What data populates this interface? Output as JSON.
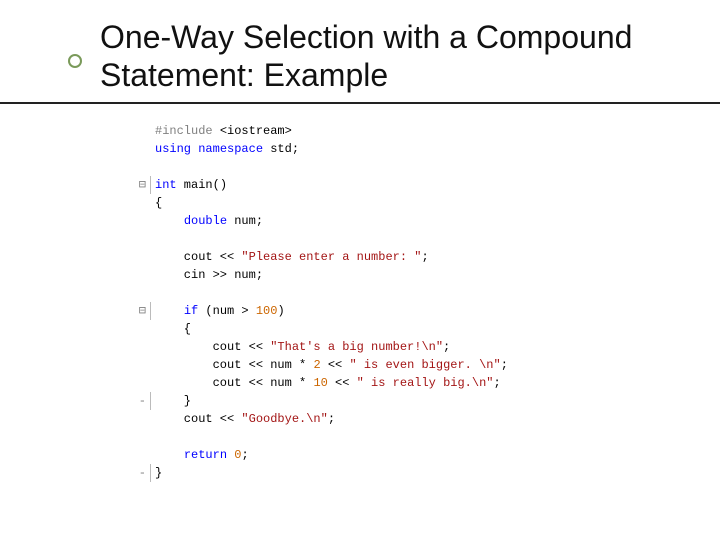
{
  "title": "One-Way Selection with a Compound Statement: Example",
  "code_lines": [
    {
      "gutter": "",
      "html": "<span class='pre'>#include </span><span class='inc'>&lt;iostream&gt;</span>"
    },
    {
      "gutter": "",
      "html": "<span class='kw'>using</span> <span class='kw'>namespace</span> std;"
    },
    {
      "gutter": "",
      "html": ""
    },
    {
      "gutter": "⊟",
      "html": "<span class='kw'>int</span> main()"
    },
    {
      "gutter": "",
      "html": "{"
    },
    {
      "gutter": "",
      "html": "    <span class='kw'>double</span> num;"
    },
    {
      "gutter": "",
      "html": ""
    },
    {
      "gutter": "",
      "html": "    cout &lt;&lt; <span class='str'>\"Please enter a number: \"</span>;"
    },
    {
      "gutter": "",
      "html": "    cin &gt;&gt; num;"
    },
    {
      "gutter": "",
      "html": ""
    },
    {
      "gutter": "⊟",
      "html": "    <span class='kw'>if</span> (num &gt; <span class='num'>100</span>)"
    },
    {
      "gutter": "",
      "html": "    {"
    },
    {
      "gutter": "",
      "html": "        cout &lt;&lt; <span class='str'>\"That's a big number!\\n\"</span>;"
    },
    {
      "gutter": "",
      "html": "        cout &lt;&lt; num * <span class='num'>2</span> &lt;&lt; <span class='str'>\" is even bigger. \\n\"</span>;"
    },
    {
      "gutter": "",
      "html": "        cout &lt;&lt; num * <span class='num'>10</span> &lt;&lt; <span class='str'>\" is really big.\\n\"</span>;"
    },
    {
      "gutter": "-",
      "html": "    }"
    },
    {
      "gutter": "",
      "html": "    cout &lt;&lt; <span class='str'>\"Goodbye.\\n\"</span>;"
    },
    {
      "gutter": "",
      "html": ""
    },
    {
      "gutter": "",
      "html": "    <span class='kw'>return</span> <span class='num'>0</span>;"
    },
    {
      "gutter": "-",
      "html": "}"
    }
  ]
}
